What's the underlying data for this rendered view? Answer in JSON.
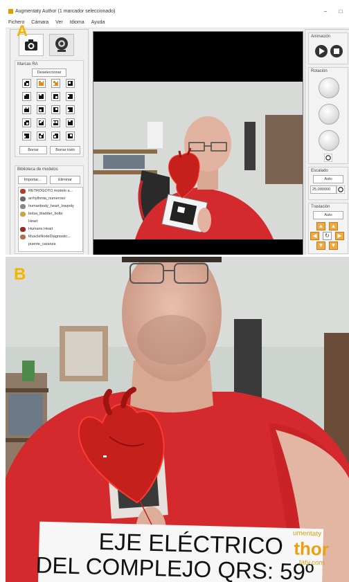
{
  "panels": {
    "a_label": "A",
    "b_label": "B"
  },
  "app": {
    "title": "Augmentaty Author (1 marcador seleccionado)",
    "window_controls": {
      "minimize": "–",
      "maximize": "□"
    },
    "menu": [
      "Fichero",
      "Cámara",
      "Ver",
      "Idioma",
      "Ayuda"
    ],
    "left": {
      "markers_title": "Marcas RA",
      "deselect_button": "Deseleccionar",
      "delete_button": "Borrar",
      "delete_all_button": "Borrar todo",
      "library_title": "Biblioteca de modelos",
      "import_button": "Importar...",
      "delete_model_button": "Eliminar",
      "models": [
        {
          "name": "RETROGOTO modelo a...",
          "color": "#b83a2a"
        },
        {
          "name": "arrhythmia_numeroso",
          "color": "#6a6a6a"
        },
        {
          "name": "humanbody_heart_lowpoly",
          "color": "#888888"
        },
        {
          "name": "bolsa_bladder_bolla",
          "color": "#c9a24a"
        },
        {
          "name": "Heart",
          "color": "#ffffff"
        },
        {
          "name": "Humans Heart",
          "color": "#9b2b22"
        },
        {
          "name": "MuscleNodeDiagnostic...",
          "color": "#b07050"
        },
        {
          "name": "puente_caranza",
          "color": "#ffffff"
        }
      ]
    },
    "right": {
      "animation_title": "Animación",
      "rotation_title": "Rotación",
      "scale_title": "Escalado",
      "scale_auto": "Auto",
      "scale_value": "25,000000",
      "translation_title": "Traslación",
      "translation_auto": "Auto"
    }
  },
  "photo": {
    "banner_line1": "EJE ELÉCTRICO",
    "banner_line2": "DEL COMPLEJO QRS: 59º",
    "logo_line1": "umentaty",
    "logo_line2": "thor",
    "logo_line3": "taty.com"
  },
  "colors": {
    "label_yellow": "#f2b600",
    "shirt_red": "#d42a2e",
    "heart_red": "#c6201c",
    "control_orange": "#f1a93c"
  }
}
